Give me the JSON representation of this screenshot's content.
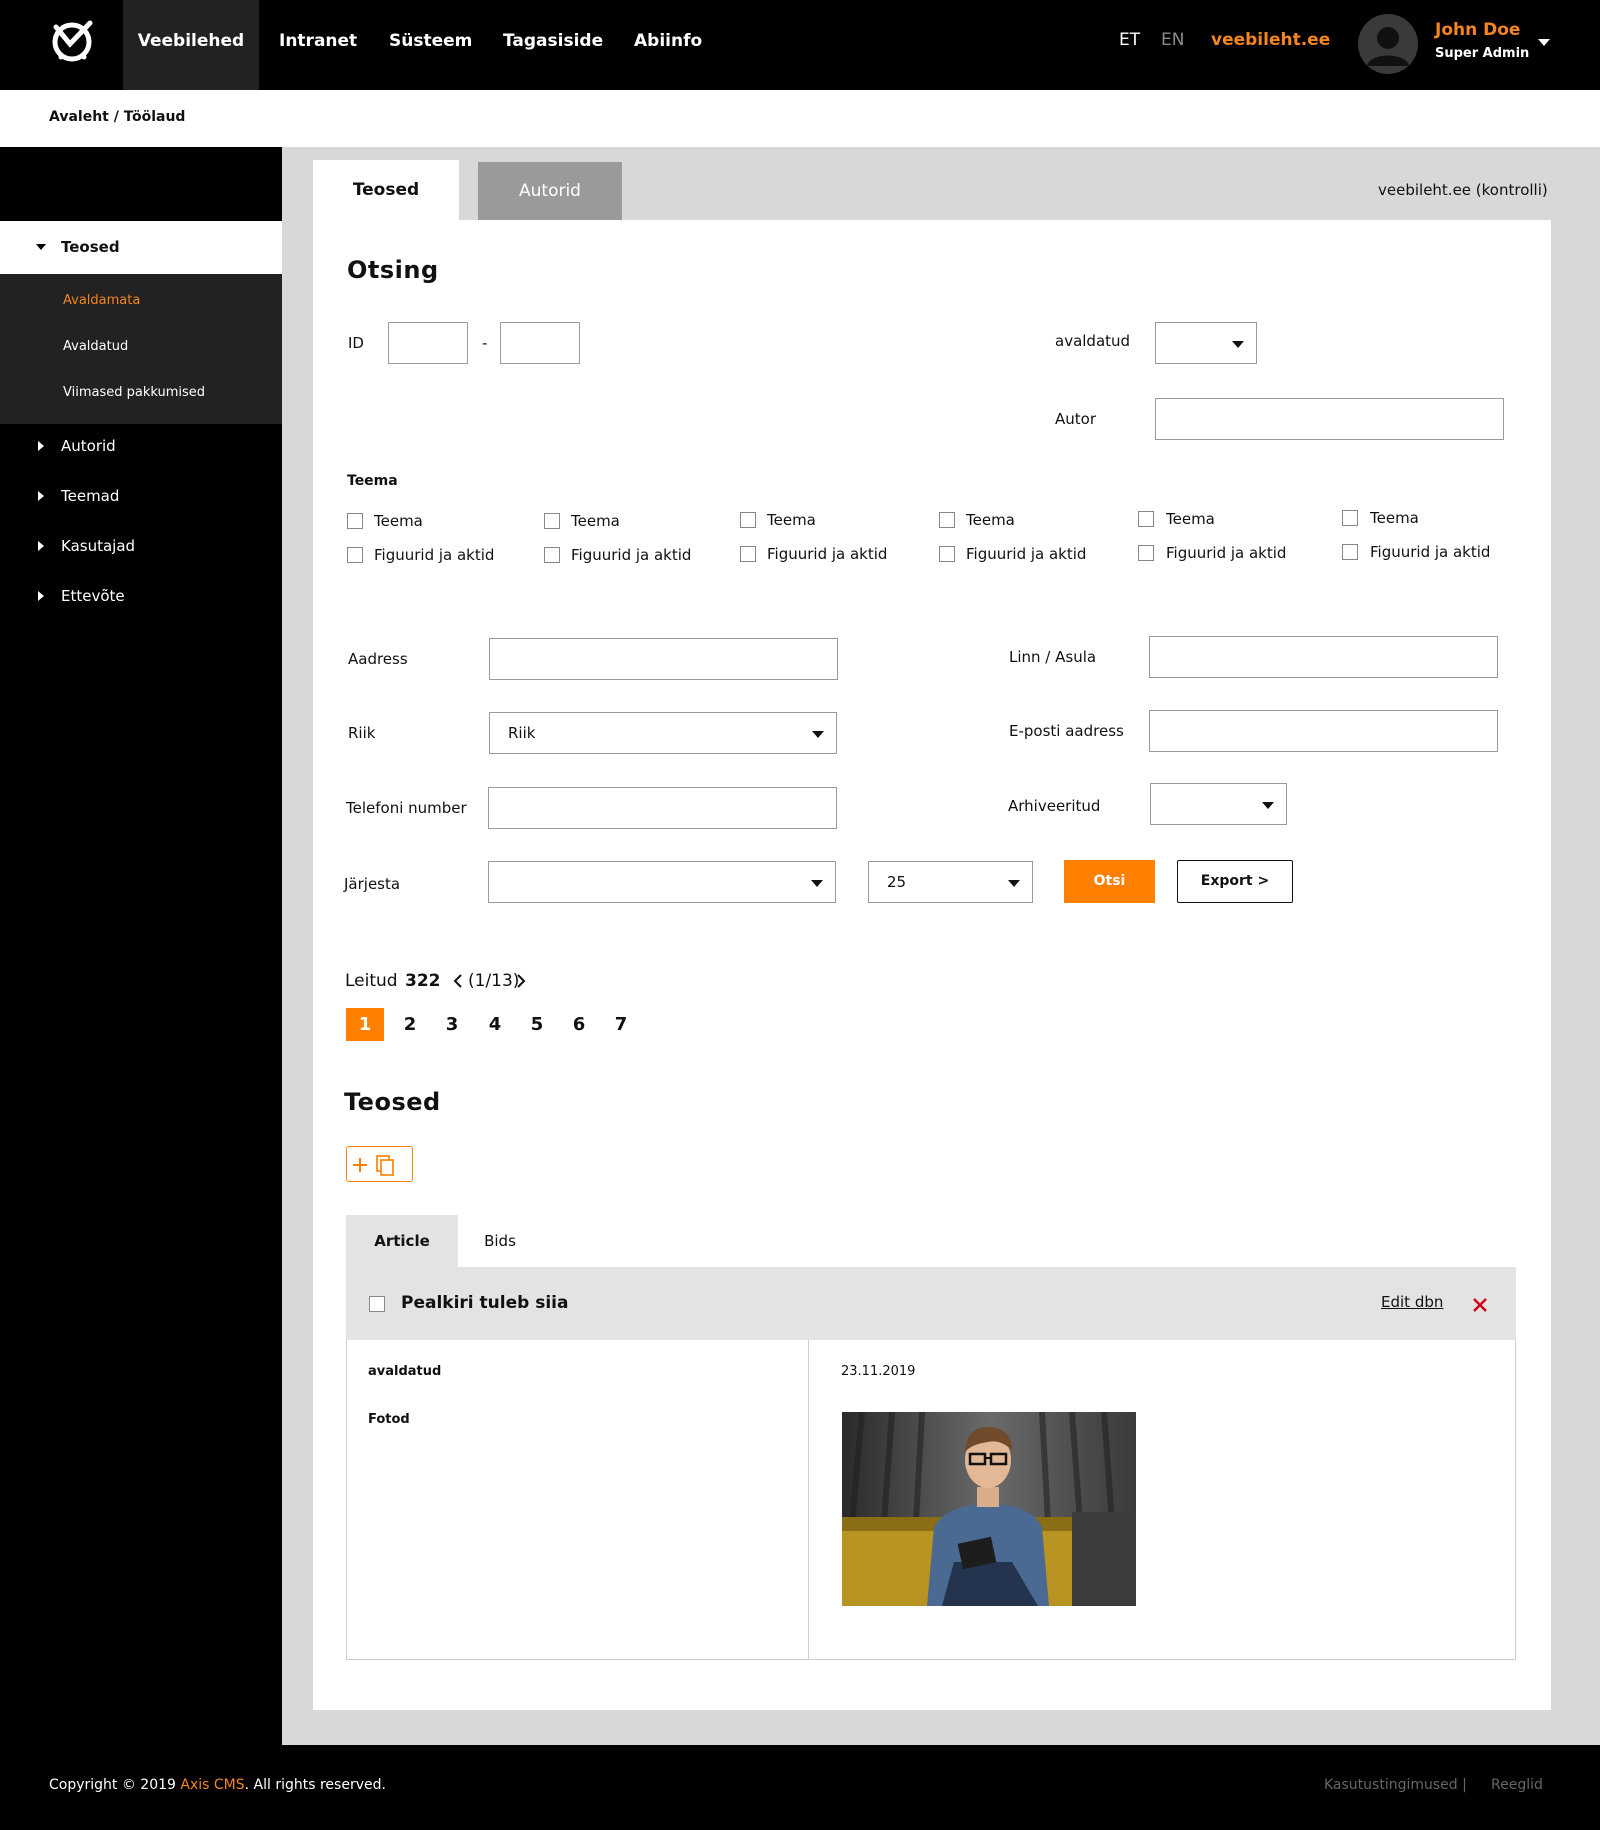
{
  "header": {
    "nav": [
      "Veebilehed",
      "Intranet",
      "Süsteem",
      "Tagasiside",
      "Abiinfo"
    ],
    "lang_et": "ET",
    "lang_en": "EN",
    "site": "veebileht.ee",
    "user_name": "John Doe",
    "user_role": "Super Admin"
  },
  "breadcrumb": "Avaleht / Töölaud",
  "sidebar": {
    "active": "Teosed",
    "sub": [
      "Avaldamata",
      "Avaldatud",
      "Viimased pakkumised"
    ],
    "items": [
      "Autorid",
      "Teemad",
      "Kasutajad",
      "Ettevõte"
    ]
  },
  "tabs": {
    "teosed": "Teosed",
    "autorid": "Autorid",
    "site_check": "veebileht.ee (kontrolli)"
  },
  "search": {
    "title": "Otsing",
    "id_label": "ID",
    "id_sep": "-",
    "published_label": "avaldatud",
    "author_label": "Autor",
    "theme_title": "Teema",
    "theme_labels": [
      "Teema",
      "Teema",
      "Teema",
      "Teema",
      "Teema",
      "Teema"
    ],
    "figure_labels": [
      "Figuurid ja aktid",
      "Figuurid ja aktid",
      "Figuurid ja aktid",
      "Figuurid ja aktid",
      "Figuurid ja aktid",
      "Figuurid ja aktid"
    ],
    "address_label": "Aadress",
    "city_label": "Linn / Asula",
    "country_label": "Riik",
    "country_value": "Riik",
    "email_label": "E-posti aadress",
    "phone_label": "Telefoni number",
    "archived_label": "Arhiveeritud",
    "sort_label": "Järjesta",
    "per_page_value": "25",
    "search_button": "Otsi",
    "export_button": "Export >"
  },
  "results": {
    "found_label": "Leitud",
    "found_count": "322",
    "page_indicator": "(1/13)",
    "pages": [
      "1",
      "2",
      "3",
      "4",
      "5",
      "6",
      "7"
    ]
  },
  "list": {
    "title": "Teosed",
    "tab_article": "Article",
    "tab_bids": "Bids",
    "item_title": "Pealkiri tuleb siia",
    "edit_link": "Edit dbn",
    "published_field": "avaldatud",
    "published_date": "23.11.2019",
    "photos_field": "Fotod"
  },
  "footer": {
    "copy_prefix": "Copyright © 2019",
    "brand": "Axis CMS",
    "copy_suffix": ". All rights reserved.",
    "terms": "Kasutustingimused |",
    "rules": "Reeglid"
  },
  "colors": {
    "accent": "#FF7F00",
    "danger": "#D0021B",
    "dark": "#000000",
    "panel_bg": "#D8D8D8"
  }
}
